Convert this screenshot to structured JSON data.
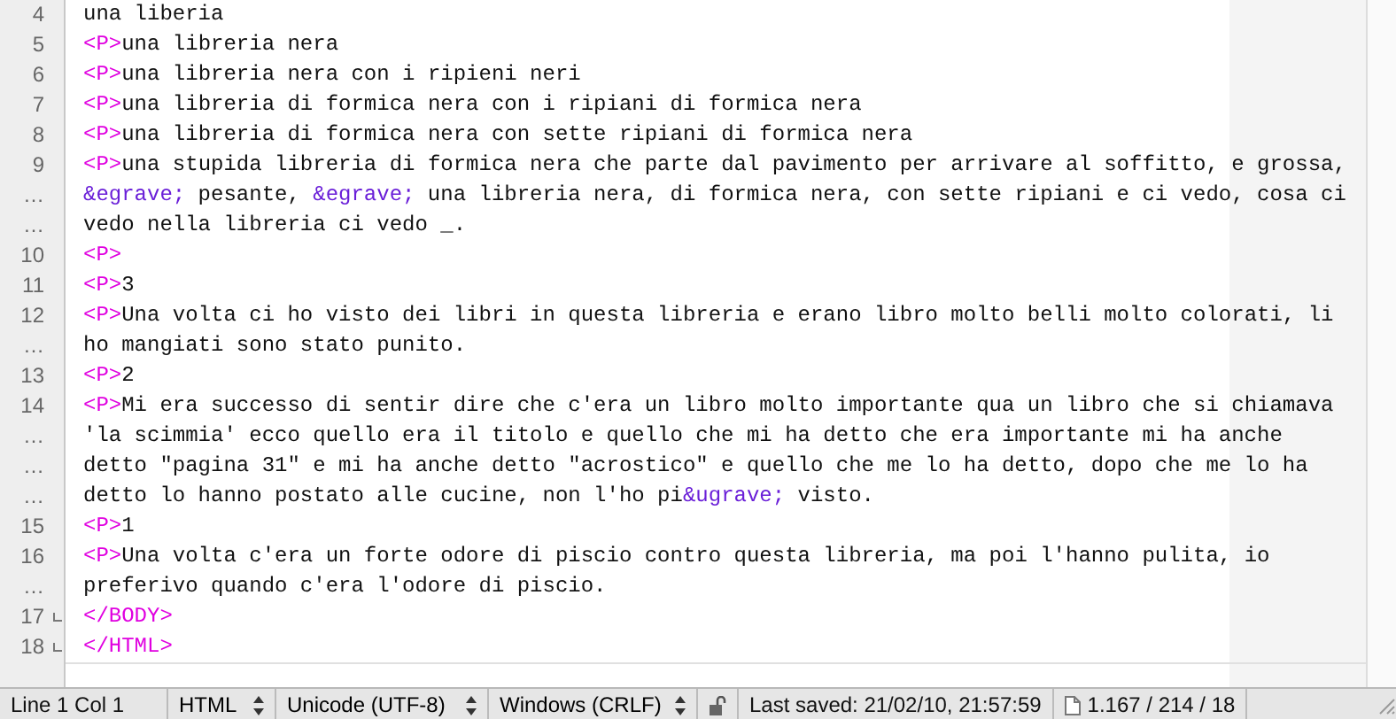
{
  "editor": {
    "rows": [
      {
        "number": "4",
        "fold_end": false,
        "segments": [
          {
            "kind": "text",
            "text": "una liberia"
          }
        ]
      },
      {
        "number": "5",
        "fold_end": false,
        "segments": [
          {
            "kind": "tag",
            "text": "<P>"
          },
          {
            "kind": "text",
            "text": "una libreria nera"
          }
        ]
      },
      {
        "number": "6",
        "fold_end": false,
        "segments": [
          {
            "kind": "tag",
            "text": "<P>"
          },
          {
            "kind": "text",
            "text": "una libreria nera con i ripieni neri"
          }
        ]
      },
      {
        "number": "7",
        "fold_end": false,
        "segments": [
          {
            "kind": "tag",
            "text": "<P>"
          },
          {
            "kind": "text",
            "text": "una libreria di formica nera con i ripiani di formica nera"
          }
        ]
      },
      {
        "number": "8",
        "fold_end": false,
        "segments": [
          {
            "kind": "tag",
            "text": "<P>"
          },
          {
            "kind": "text",
            "text": "una libreria di formica nera con sette ripiani di formica nera"
          }
        ]
      },
      {
        "number": "9",
        "fold_end": false,
        "segments": [
          {
            "kind": "tag",
            "text": "<P>"
          },
          {
            "kind": "text",
            "text": "una stupida libreria di formica nera che parte dal pavimento per arrivare al soffitto, e grossa,"
          }
        ]
      },
      {
        "number": "…",
        "fold_end": false,
        "segments": [
          {
            "kind": "entity",
            "text": "&egrave;"
          },
          {
            "kind": "text",
            "text": " pesante, "
          },
          {
            "kind": "entity",
            "text": "&egrave;"
          },
          {
            "kind": "text",
            "text": " una libreria nera, di formica nera, con sette ripiani e ci vedo, cosa ci"
          }
        ]
      },
      {
        "number": "…",
        "fold_end": false,
        "segments": [
          {
            "kind": "text",
            "text": "vedo nella libreria ci vedo _."
          }
        ]
      },
      {
        "number": "10",
        "fold_end": false,
        "segments": [
          {
            "kind": "tag",
            "text": "<P>"
          }
        ]
      },
      {
        "number": "11",
        "fold_end": false,
        "segments": [
          {
            "kind": "tag",
            "text": "<P>"
          },
          {
            "kind": "text",
            "text": "3"
          }
        ]
      },
      {
        "number": "12",
        "fold_end": false,
        "segments": [
          {
            "kind": "tag",
            "text": "<P>"
          },
          {
            "kind": "text",
            "text": "Una volta ci ho visto dei libri in questa libreria e erano libro molto belli molto colorati, li"
          }
        ]
      },
      {
        "number": "…",
        "fold_end": false,
        "segments": [
          {
            "kind": "text",
            "text": "ho mangiati sono stato punito."
          }
        ]
      },
      {
        "number": "13",
        "fold_end": false,
        "segments": [
          {
            "kind": "tag",
            "text": "<P>"
          },
          {
            "kind": "text",
            "text": "2"
          }
        ]
      },
      {
        "number": "14",
        "fold_end": false,
        "segments": [
          {
            "kind": "tag",
            "text": "<P>"
          },
          {
            "kind": "text",
            "text": "Mi era successo di sentir dire che c'era un libro molto importante qua un libro che si chiamava"
          }
        ]
      },
      {
        "number": "…",
        "fold_end": false,
        "segments": [
          {
            "kind": "text",
            "text": "'la scimmia' ecco quello era il titolo e quello che mi ha detto che era importante mi ha anche"
          }
        ]
      },
      {
        "number": "…",
        "fold_end": false,
        "segments": [
          {
            "kind": "text",
            "text": "detto \"pagina 31\" e mi ha anche detto \"acrostico\" e quello che me lo ha detto, dopo che me lo ha"
          }
        ]
      },
      {
        "number": "…",
        "fold_end": false,
        "segments": [
          {
            "kind": "text",
            "text": "detto lo hanno postato alle cucine, non l'ho pi"
          },
          {
            "kind": "entity",
            "text": "&ugrave;"
          },
          {
            "kind": "text",
            "text": " visto."
          }
        ]
      },
      {
        "number": "15",
        "fold_end": false,
        "segments": [
          {
            "kind": "tag",
            "text": "<P>"
          },
          {
            "kind": "text",
            "text": "1"
          }
        ]
      },
      {
        "number": "16",
        "fold_end": false,
        "segments": [
          {
            "kind": "tag",
            "text": "<P>"
          },
          {
            "kind": "text",
            "text": "Una volta c'era un forte odore di piscio contro questa libreria, ma poi l'hanno pulita, io"
          }
        ]
      },
      {
        "number": "…",
        "fold_end": false,
        "segments": [
          {
            "kind": "text",
            "text": "preferivo quando c'era l'odore di piscio."
          }
        ]
      },
      {
        "number": "17",
        "fold_end": true,
        "segments": [
          {
            "kind": "tag",
            "text": "</BODY>"
          }
        ]
      },
      {
        "number": "18",
        "fold_end": true,
        "segments": [
          {
            "kind": "tag",
            "text": "</HTML>"
          }
        ]
      }
    ]
  },
  "status_bar": {
    "position": "Line 1 Col 1",
    "language": "HTML",
    "encoding": "Unicode (UTF-8)",
    "line_endings": "Windows (CRLF)",
    "last_saved": "Last saved: 21/02/10, 21:57:59",
    "counts": "1.167 / 214 / 18"
  }
}
